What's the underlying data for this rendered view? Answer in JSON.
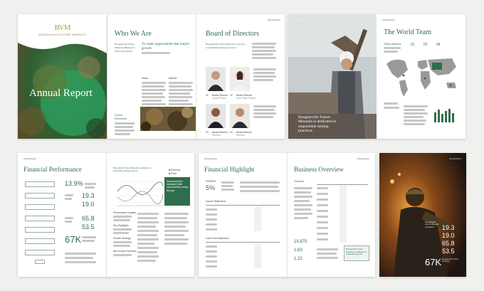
{
  "cover": {
    "logo_mark": "BVM",
    "logo_text": "BOUGAINVILLE FUTURE MINERALS",
    "title": "Annual Report"
  },
  "who_we_are": {
    "title": "Who We Are",
    "lead": "Bougainville Future Minerals Mining for Shared Prosperity",
    "intro": "To create opportunities that inspire growth",
    "col1_head": "Vision",
    "col2_head": "Mission",
    "contact_head": "Contact Information"
  },
  "board": {
    "header": "Annual Report",
    "title": "Board of Directors",
    "lead": "Bougainville Future Minerals is devoted to sustainable mining practices",
    "members": [
      {
        "num": "01",
        "name": "Board Director",
        "role": "Chair Person"
      },
      {
        "num": "02",
        "name": "Board Director",
        "role": "Vice Chair Person"
      },
      {
        "num": "03",
        "name": "Board Director",
        "role": "Director"
      },
      {
        "num": "04",
        "name": "Board Director",
        "role": "Director"
      }
    ]
  },
  "miner_page": {
    "header": "Annual Report",
    "caption": "Bougainville Future Minerals is dedicated to responsible mining practices"
  },
  "world_team": {
    "header": "Annual Report",
    "title": "The World Team",
    "lead": "Global presence",
    "stat1": "01",
    "stat2": "02",
    "stat3": "04"
  },
  "financial_performance": {
    "header": "Annual Report",
    "title": "Financial Performance",
    "big_pct": "13.9%",
    "stats": [
      "19.3",
      "19.0",
      "65.8",
      "53.5"
    ],
    "big_k": "67K",
    "right_lead": "Bougainville Future Minerals is dedicated to responsible mining practices",
    "legend": [
      "Revenue",
      "Profit"
    ],
    "callout": "Gold production increased while costs declined during the year",
    "side_heads": [
      "Performance Insights",
      "Key Highlights",
      "Growth Strategy",
      "Net Income Overview"
    ]
  },
  "financial_highlight": {
    "header": "Annual Report",
    "title": "Financial Highlight",
    "big": "5%",
    "sub1": "Income Statement",
    "sub2": "Cash Flow Statement"
  },
  "business_overview": {
    "header": "Annual Report",
    "title": "Business Overview",
    "lead": "Overview",
    "stats": [
      "19,875",
      "1,83",
      "1,22"
    ],
    "note": "Bougainville Future Minerals is dedicated to sustainable growth"
  },
  "back_page": {
    "header": "Annual Report",
    "small": "Bougainville Future Minerals operations",
    "stats": [
      "19.3",
      "19.0",
      "65.8",
      "53.5"
    ],
    "big_k": "67K",
    "big_k_caption": "Bougainville Future Minerals"
  },
  "colors": {
    "accent": "#2e6e4a",
    "gold": "#b89a55"
  }
}
